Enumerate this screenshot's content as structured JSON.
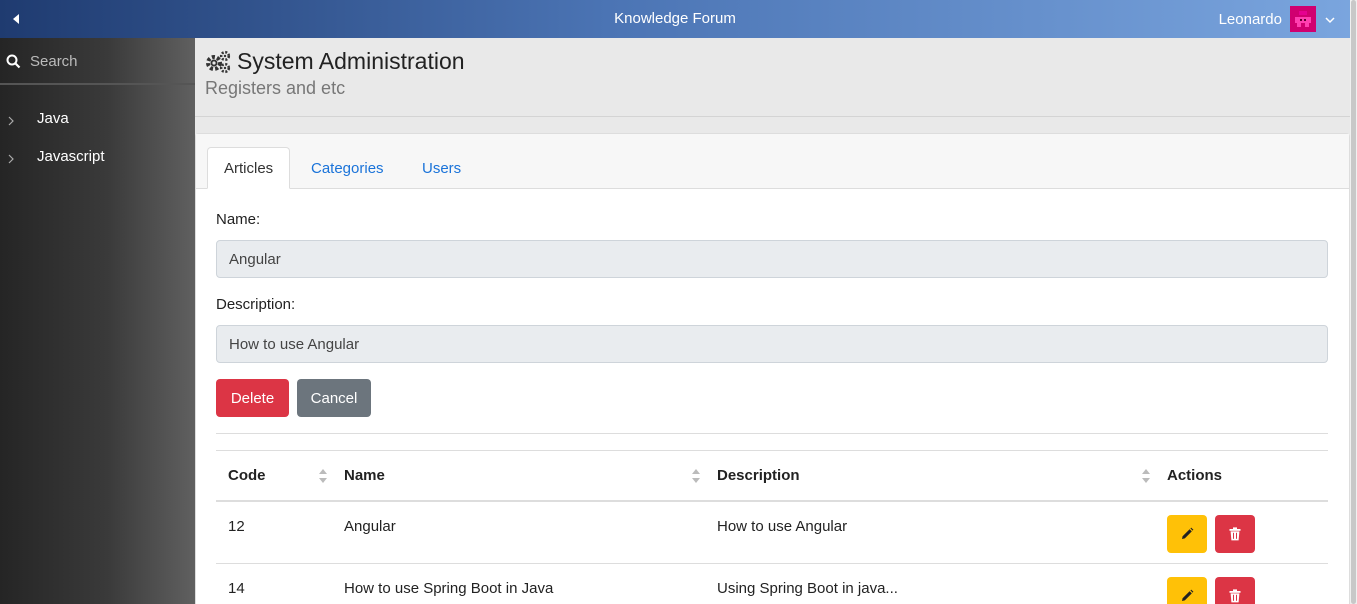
{
  "header": {
    "title": "Knowledge Forum",
    "user_name": "Leonardo",
    "avatar_color": "#d00070"
  },
  "sidebar": {
    "search_placeholder": "Search",
    "items": [
      {
        "label": "Java"
      },
      {
        "label": "Javascript"
      }
    ]
  },
  "page": {
    "title": "System Administration",
    "subtitle": "Registers and etc"
  },
  "tabs": [
    {
      "label": "Articles",
      "active": true
    },
    {
      "label": "Categories",
      "active": false
    },
    {
      "label": "Users",
      "active": false
    }
  ],
  "form": {
    "name_label": "Name:",
    "name_value": "Angular",
    "description_label": "Description:",
    "description_value": "How to use Angular",
    "delete_label": "Delete",
    "cancel_label": "Cancel"
  },
  "table": {
    "columns": [
      "Code",
      "Name",
      "Description",
      "Actions"
    ],
    "rows": [
      {
        "code": "12",
        "name": "Angular",
        "description": "How to use Angular"
      },
      {
        "code": "14",
        "name": "How to use Spring Boot in Java",
        "description": "Using Spring Boot in java..."
      }
    ]
  },
  "colors": {
    "danger": "#dc3545",
    "warning": "#ffc107",
    "secondary": "#6c757d",
    "link": "#1a73d9"
  }
}
